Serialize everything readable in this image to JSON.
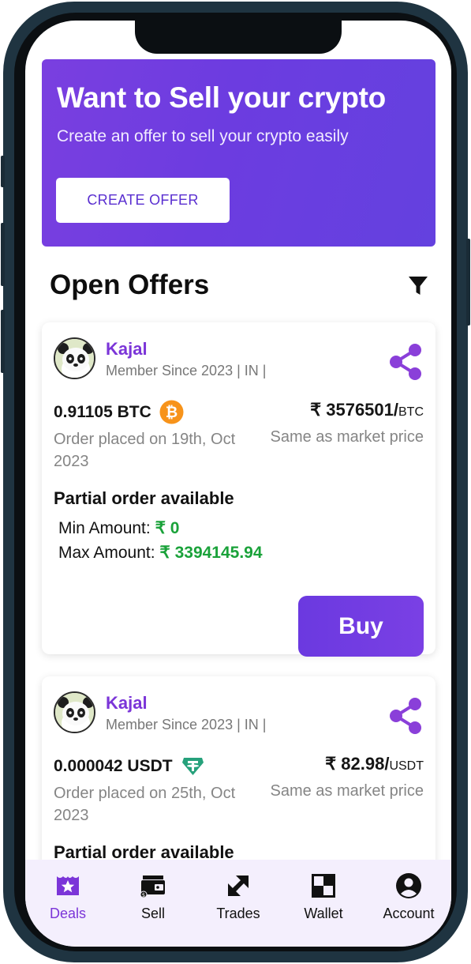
{
  "banner": {
    "title": "Want to Sell your crypto",
    "subtitle": "Create an offer to sell your crypto easily",
    "button_label": "CREATE OFFER"
  },
  "section": {
    "title": "Open Offers",
    "filter_icon": "filter-icon"
  },
  "offers": [
    {
      "user_name": "Kajal",
      "member_info": "Member Since 2023 | IN |",
      "amount": "0.91105 BTC",
      "coin_icon": "bitcoin-icon",
      "price": "₹ 3576501/",
      "price_unit": "BTC",
      "order_date": "Order placed on 19th, Oct 2023",
      "price_note": "Same as market price",
      "partial_label": "Partial order available",
      "min_label": "Min Amount: ",
      "min_value": "₹ 0",
      "max_label": "Max Amount: ",
      "max_value": "₹ 3394145.94",
      "action_label": "Buy"
    },
    {
      "user_name": "Kajal",
      "member_info": "Member Since 2023 | IN |",
      "amount": "0.000042 USDT",
      "coin_icon": "tether-icon",
      "price": "₹ 82.98/",
      "price_unit": "USDT",
      "order_date": "Order placed on 25th, Oct 2023",
      "price_note": "Same as market price",
      "partial_label": "Partial order available"
    }
  ],
  "nav": {
    "items": [
      {
        "label": "Deals",
        "icon": "deals-star-icon",
        "active": true
      },
      {
        "label": "Sell",
        "icon": "wallet-sell-icon",
        "active": false
      },
      {
        "label": "Trades",
        "icon": "trade-arrows-icon",
        "active": false
      },
      {
        "label": "Wallet",
        "icon": "wallet-grid-icon",
        "active": false
      },
      {
        "label": "Account",
        "icon": "account-icon",
        "active": false
      }
    ]
  },
  "colors": {
    "accent": "#7b35d8",
    "banner": "#6c3ce0",
    "positive": "#1aa23a",
    "bitcoin": "#f7931a",
    "tether": "#26a17b",
    "frame": "#1f3441"
  }
}
